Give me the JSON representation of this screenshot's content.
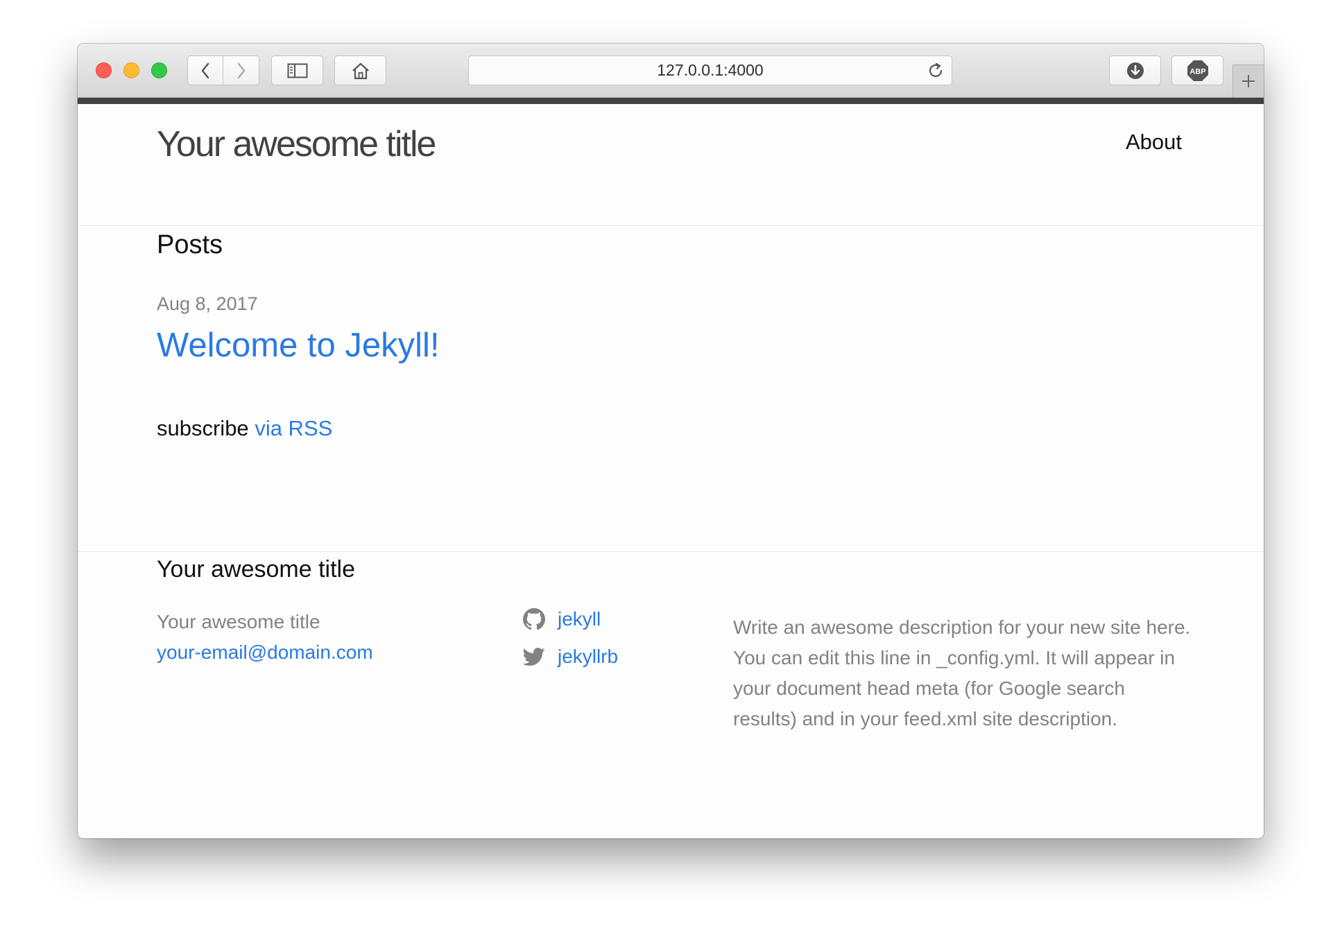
{
  "browser": {
    "url": "127.0.0.1:4000",
    "adblock_label": "ABP"
  },
  "header": {
    "site_title": "Your awesome title",
    "nav": [
      {
        "label": "About"
      }
    ]
  },
  "main": {
    "heading": "Posts",
    "posts": [
      {
        "date": "Aug 8, 2017",
        "title": "Welcome to Jekyll!"
      }
    ],
    "subscribe_text": "subscribe",
    "subscribe_link": "via RSS"
  },
  "footer": {
    "heading": "Your awesome title",
    "name": "Your awesome title",
    "email": "your-email@domain.com",
    "social": [
      {
        "icon": "github-icon",
        "label": "jekyll"
      },
      {
        "icon": "twitter-icon",
        "label": "jekyllrb"
      }
    ],
    "description": "Write an awesome description for your new site here. You can edit this line in _config.yml. It will appear in your document head meta (for Google search results) and in your feed.xml site description."
  },
  "colors": {
    "link": "#2a7ae2",
    "text": "#111111",
    "muted": "#828282",
    "accent_bar": "#424242"
  }
}
